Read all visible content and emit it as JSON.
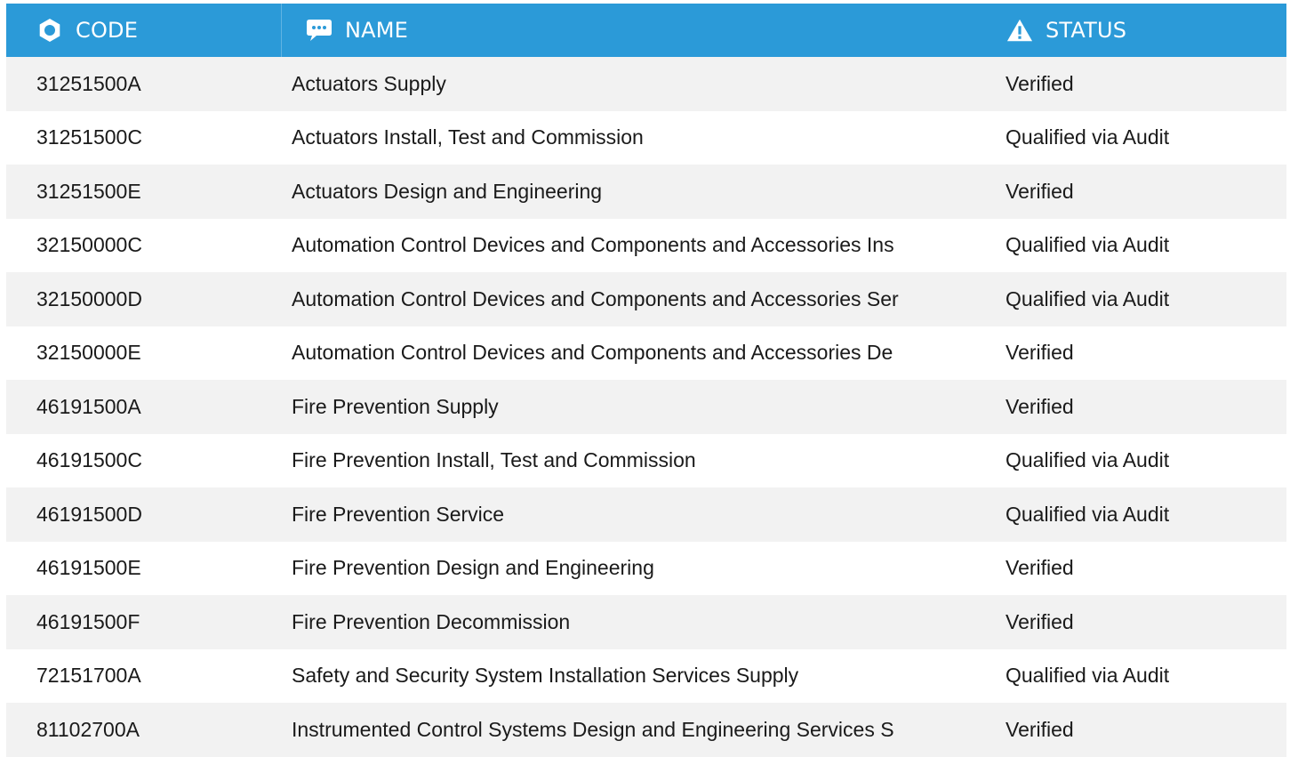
{
  "header": {
    "code_label": "CODE",
    "name_label": "NAME",
    "status_label": "STATUS",
    "code_icon": "gear-icon",
    "name_icon": "chat-bubble-icon",
    "status_icon": "warning-icon"
  },
  "colors": {
    "header_bg": "#2b9ad8",
    "row_alt_bg": "#f2f2f2"
  },
  "rows": [
    {
      "code": "31251500A",
      "name": "Actuators Supply",
      "status": "Verified"
    },
    {
      "code": "31251500C",
      "name": "Actuators Install, Test and Commission",
      "status": "Qualified via Audit"
    },
    {
      "code": "31251500E",
      "name": "Actuators Design and Engineering",
      "status": "Verified"
    },
    {
      "code": "32150000C",
      "name": "Automation Control Devices and Components and Accessories Ins",
      "status": "Qualified via Audit"
    },
    {
      "code": "32150000D",
      "name": "Automation Control Devices and Components and Accessories Ser",
      "status": "Qualified via Audit"
    },
    {
      "code": "32150000E",
      "name": "Automation Control Devices and Components and Accessories De",
      "status": "Verified"
    },
    {
      "code": "46191500A",
      "name": "Fire Prevention Supply",
      "status": "Verified"
    },
    {
      "code": "46191500C",
      "name": "Fire Prevention Install, Test and Commission",
      "status": "Qualified via Audit"
    },
    {
      "code": "46191500D",
      "name": "Fire Prevention Service",
      "status": "Qualified via Audit"
    },
    {
      "code": "46191500E",
      "name": "Fire Prevention Design and Engineering",
      "status": "Verified"
    },
    {
      "code": "46191500F",
      "name": "Fire Prevention Decommission",
      "status": "Verified"
    },
    {
      "code": "72151700A",
      "name": "Safety and Security System Installation Services Supply",
      "status": "Qualified via Audit"
    },
    {
      "code": "81102700A",
      "name": "Instrumented Control Systems Design and Engineering Services S",
      "status": "Verified"
    }
  ]
}
